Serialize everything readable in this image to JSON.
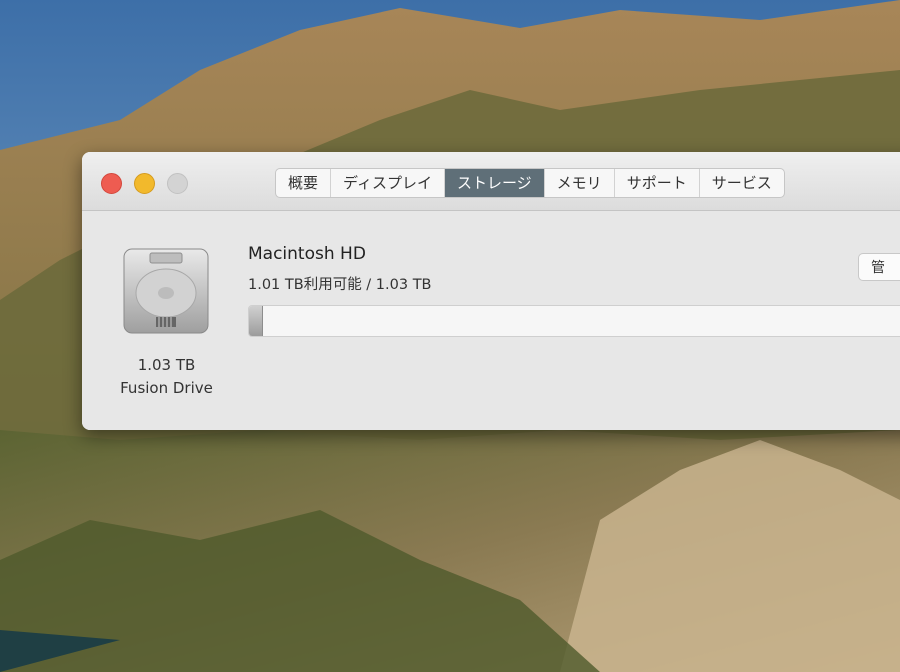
{
  "window": {
    "tabs": [
      {
        "label": "概要"
      },
      {
        "label": "ディスプレイ"
      },
      {
        "label": "ストレージ"
      },
      {
        "label": "メモリ"
      },
      {
        "label": "サポート"
      },
      {
        "label": "サービス"
      }
    ],
    "active_tab": "ストレージ"
  },
  "storage": {
    "drive_size": "1.03 TB",
    "drive_type": "Fusion Drive",
    "volume_name": "Macintosh HD",
    "usage_text": "1.01 TB利用可能 / 1.03 TB",
    "used_fraction": 0.02,
    "manage_button_label": "管"
  },
  "icons": [
    "hard-drive-icon"
  ],
  "colors": {
    "close": "#ee5c51",
    "minimize": "#f2b92c",
    "zoom_disabled": "#d3d3d3",
    "active_tab": "#5f6f78"
  }
}
